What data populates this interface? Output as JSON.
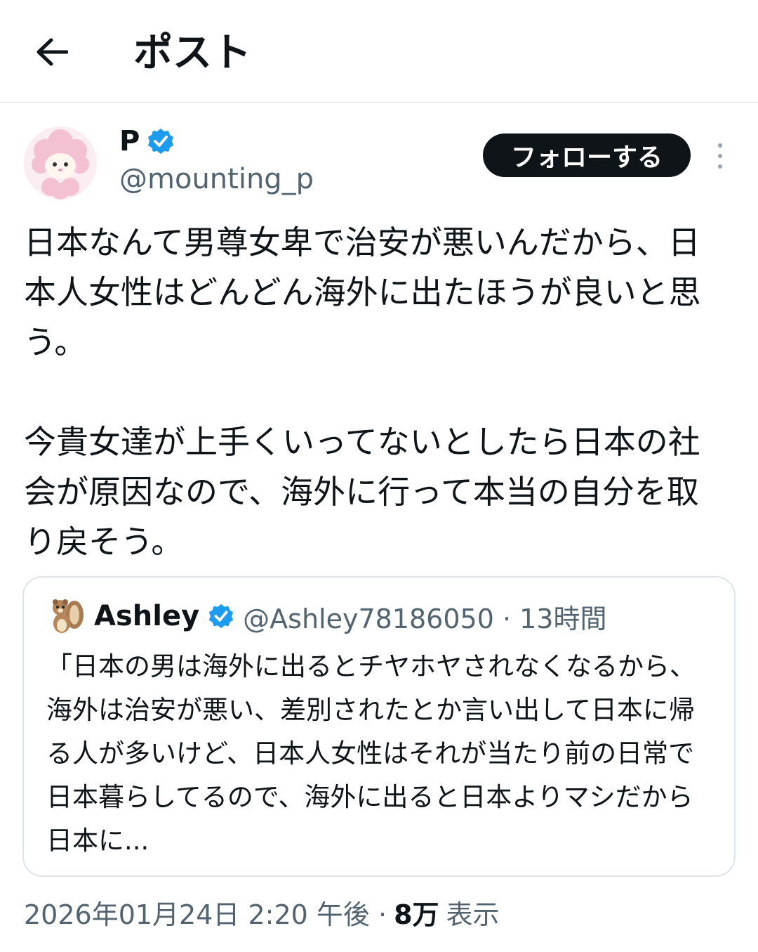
{
  "header": {
    "title": "ポスト",
    "back_icon": "arrow-left-icon"
  },
  "author": {
    "display_name": "P",
    "handle": "@mounting_p",
    "verified_icon": "verified-badge-icon",
    "avatar_icon": "pink-sheep-character-avatar"
  },
  "follow_button": {
    "label": "フォローする"
  },
  "more_icon": "more-vertical-icon",
  "tweet": {
    "text": "日本なんて男尊女卑で治安が悪いんだから、日本人女性はどんどん海外に出たほうが良いと思う。\n\n今貴女達が上手くいってないとしたら日本の社会が原因なので、海外に行って本当の自分を取り戻そう。"
  },
  "quote": {
    "avatar_icon": "squirrel-avatar",
    "name": "Ashley",
    "handle_time": "@Ashley78186050 · 13時間",
    "text": "「日本の男は海外に出るとチヤホヤされなくなるから、海外は治安が悪い、差別されたとか言い出して日本に帰る人が多いけど、日本人女性はそれが当たり前の日常で日本暮らしてるので、海外に出ると日本よりマシだから日本に..."
  },
  "meta": {
    "timestamp": "2026年01月24日 2:20 午後 ·",
    "views_count": "8万",
    "views_label": "表示"
  },
  "colors": {
    "text": "#0f1419",
    "secondary": "#536471",
    "verified": "#1d9bf0",
    "border": "#dfe4e8"
  }
}
